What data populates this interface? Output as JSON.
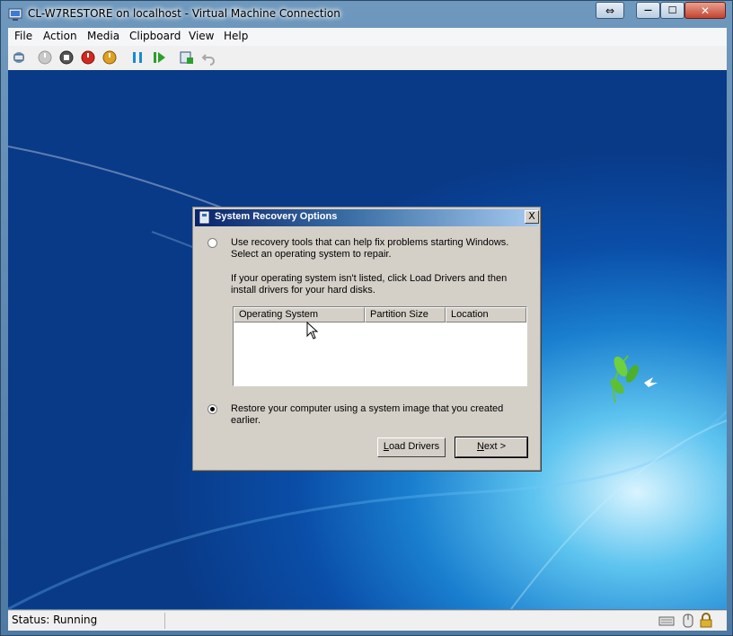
{
  "window": {
    "title": "CL-W7RESTORE on localhost - Virtual Machine Connection",
    "controls": {
      "restore_glyph": "⇔",
      "minimize_glyph": "—",
      "maximize_glyph": "☐",
      "close_glyph": "✕"
    }
  },
  "menubar": {
    "items": [
      "File",
      "Action",
      "Media",
      "Clipboard",
      "View",
      "Help"
    ]
  },
  "toolbar": {
    "icons": [
      "ctrl-alt-del-icon",
      "start-icon",
      "turn-off-icon",
      "shut-down-icon",
      "save-icon",
      "pause-icon",
      "resume-icon",
      "snapshot-icon",
      "revert-icon"
    ]
  },
  "dialog": {
    "title": "System Recovery Options",
    "close_glyph": "X",
    "option1": {
      "line1": "Use recovery tools that can help fix problems starting Windows.",
      "line2": "Select an operating system to repair.",
      "selected": false
    },
    "note": {
      "line1": "If your operating system isn't listed, click Load Drivers and then",
      "line2": "install drivers for your hard disks."
    },
    "table": {
      "columns": [
        "Operating System",
        "Partition Size",
        "Location"
      ],
      "rows": []
    },
    "option2": {
      "line1": "Restore your computer using a system image that you created",
      "line2": "earlier.",
      "selected": true
    },
    "buttons": {
      "load_drivers": {
        "ul": "L",
        "rest": "oad Drivers"
      },
      "next": {
        "ul": "N",
        "rest": "ext >"
      }
    }
  },
  "status": {
    "text": "Status: Running"
  },
  "colors": {
    "desktop_blue": "#0a4ea8",
    "dialog_title": "#0a246a",
    "dialog_bg": "#d4d0c8"
  }
}
